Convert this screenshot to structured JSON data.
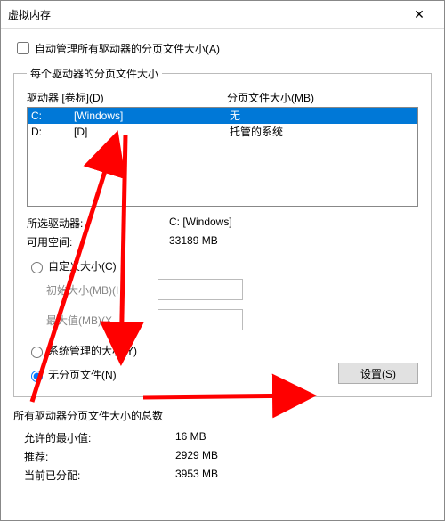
{
  "title": "虚拟内存",
  "auto_manage_label": "自动管理所有驱动器的分页文件大小(A)",
  "auto_manage_checked": false,
  "group1_title": "每个驱动器的分页文件大小",
  "header": {
    "drive": "驱动器 [卷标](D)",
    "paging": "分页文件大小(MB)"
  },
  "drives": [
    {
      "letter": "C:",
      "volume": "[Windows]",
      "paging": "无",
      "selected": true
    },
    {
      "letter": "D:",
      "volume": "[D]",
      "paging": "托管的系统",
      "selected": false
    }
  ],
  "selected_drive_label": "所选驱动器:",
  "selected_drive_value": "C:  [Windows]",
  "available_label": "可用空间:",
  "available_value": "33189 MB",
  "radio_custom": "自定义大小(C)",
  "initial_label": "初始大小(MB)(I",
  "max_label": "最大值(MB)(X",
  "radio_system": "系统管理的大小(Y)",
  "radio_none": "无分页文件(N)",
  "radio_selected": "none",
  "set_button": "设置(S)",
  "totals_title": "所有驱动器分页文件大小的总数",
  "min_label": "允许的最小值:",
  "min_value": "16 MB",
  "rec_label": "推荐:",
  "rec_value": "2929 MB",
  "cur_label": "当前已分配:",
  "cur_value": "3953 MB",
  "arrow_color": "#ff0000"
}
